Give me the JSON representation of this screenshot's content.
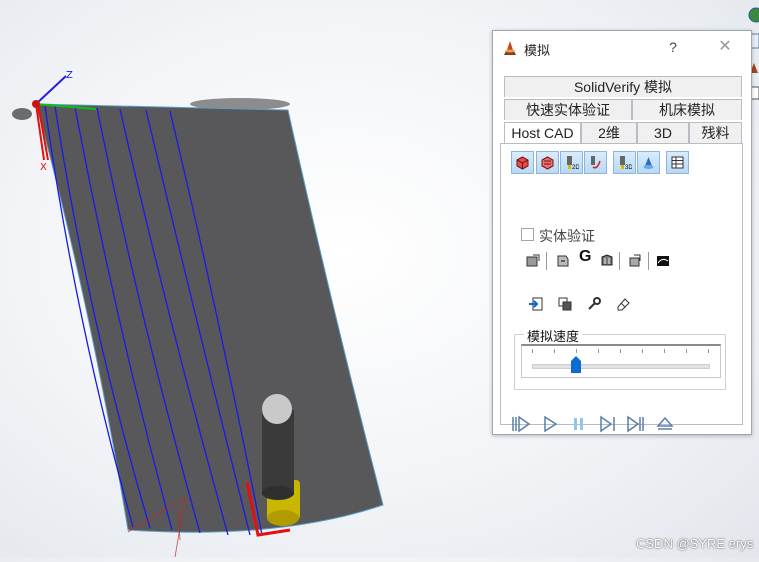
{
  "dialog": {
    "title": "模拟",
    "help_label": "?",
    "close_label": "✕"
  },
  "tabs": {
    "row1": [
      {
        "label": "SolidVerify 模拟"
      }
    ],
    "row2": [
      {
        "label": "快速实体验证"
      },
      {
        "label": "机床模拟"
      }
    ],
    "row3": [
      {
        "label": "Host CAD",
        "active": true
      },
      {
        "label": "2维"
      },
      {
        "label": "3D"
      },
      {
        "label": "残料"
      }
    ]
  },
  "mode_toolbar": {
    "icons": [
      "stock-cube-icon",
      "part-cube-icon",
      "tool-holder-2d-icon",
      "tool-path-icon",
      "tool-holder-3d-icon",
      "cutter-icon",
      "table-icon"
    ]
  },
  "solid_verify": {
    "checkbox_label": "实体验证",
    "checked": false,
    "g_label": "G"
  },
  "speed": {
    "label": "模拟速度",
    "value_fraction": 0.25
  },
  "playback": {
    "icons": [
      "rewind-start-icon",
      "play-icon",
      "pause-icon",
      "step-forward-icon",
      "step-end-icon",
      "eject-icon"
    ]
  },
  "colors": {
    "accent": "#0a6bd6",
    "toolpath": "#1a1ae6",
    "surface": "#5a5a5c",
    "tool_tip": "#d9c400"
  },
  "watermark": "CSDN @SYRE erys"
}
